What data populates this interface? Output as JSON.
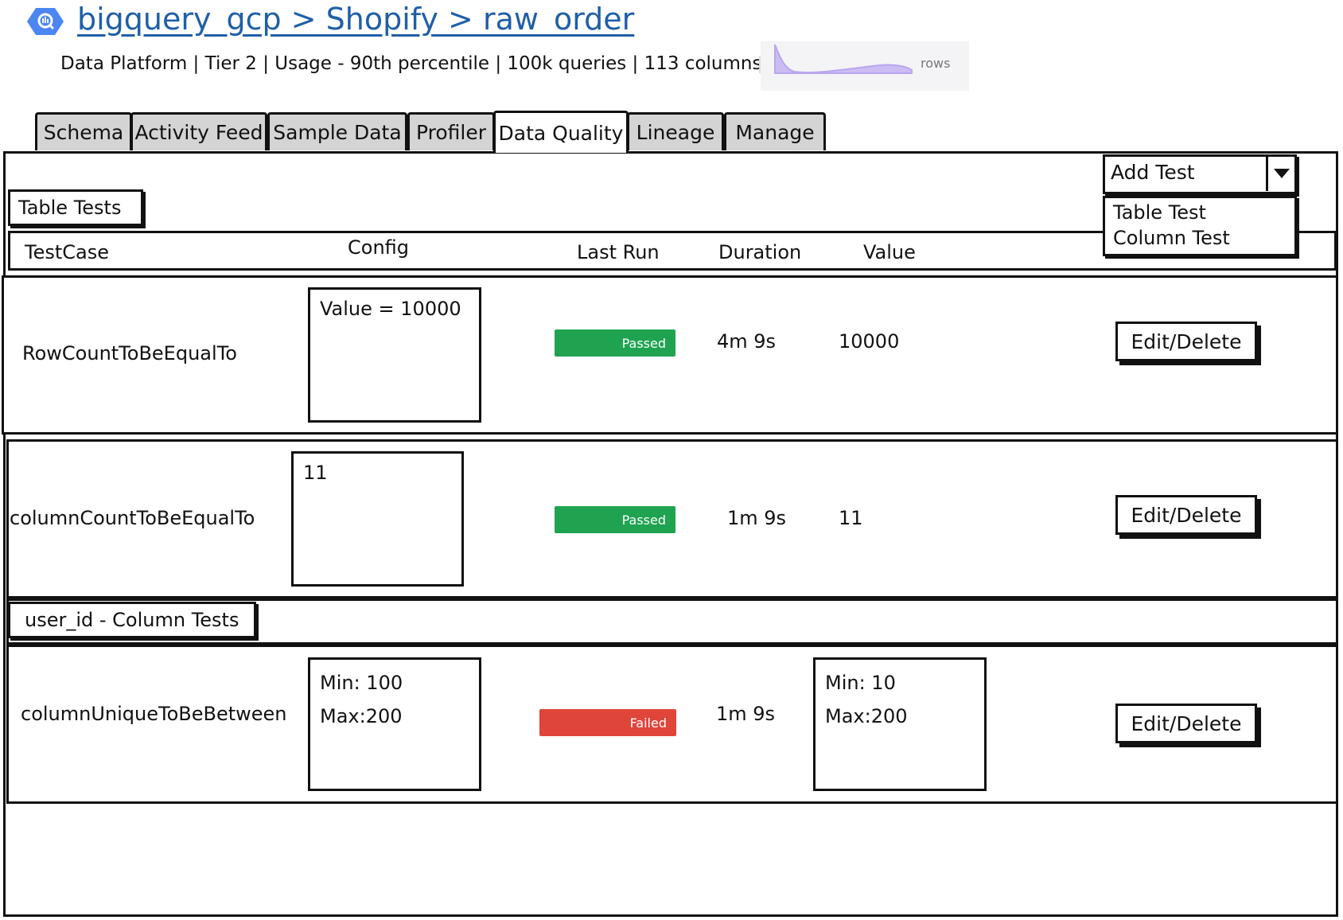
{
  "header": {
    "breadcrumb": "bigquery_gcp > Shopify > raw_order",
    "meta": "Data Platform | Tier 2 | Usage - 90th percentile | 100k queries | 113 columns",
    "sparkline_label": "rows"
  },
  "tabs": [
    {
      "label": "Schema"
    },
    {
      "label": "Activity Feed"
    },
    {
      "label": "Sample Data"
    },
    {
      "label": "Profiler"
    },
    {
      "label": "Data Quality",
      "active": true
    },
    {
      "label": "Lineage"
    },
    {
      "label": "Manage"
    }
  ],
  "add_test": {
    "label": "Add Test",
    "options": [
      "Table Test",
      "Column Test"
    ]
  },
  "sections": {
    "table_tests": "Table Tests",
    "column_tests": "user_id - Column Tests"
  },
  "columns": {
    "testcase": "TestCase",
    "config": "Config",
    "last_run": "Last Run",
    "duration": "Duration",
    "value": "Value"
  },
  "rows": [
    {
      "testcase": "RowCountToBeEqualTo",
      "config": "Value = 10000",
      "status": "Passed",
      "duration": "4m 9s",
      "value": "10000",
      "action": "Edit/Delete"
    },
    {
      "testcase": "columnCountToBeEqualTo",
      "config": "11",
      "status": "Passed",
      "duration": "1m 9s",
      "value": "11",
      "action": "Edit/Delete"
    },
    {
      "testcase": "columnUniqueToBeBetween",
      "config_min": "Min: 100",
      "config_max": "Max:200",
      "status": "Failed",
      "duration": "1m 9s",
      "value_min": "Min: 10",
      "value_max": "Max:200",
      "action": "Edit/Delete"
    }
  ],
  "colors": {
    "link": "#1f5fa8",
    "passed": "#1fa350",
    "failed": "#e0453a",
    "sparkline": "#b9a6ee",
    "bq_icon": "#4b86f2"
  },
  "icons": {
    "bigquery": "bigquery-icon",
    "dropdown": "chevron-down-icon"
  }
}
